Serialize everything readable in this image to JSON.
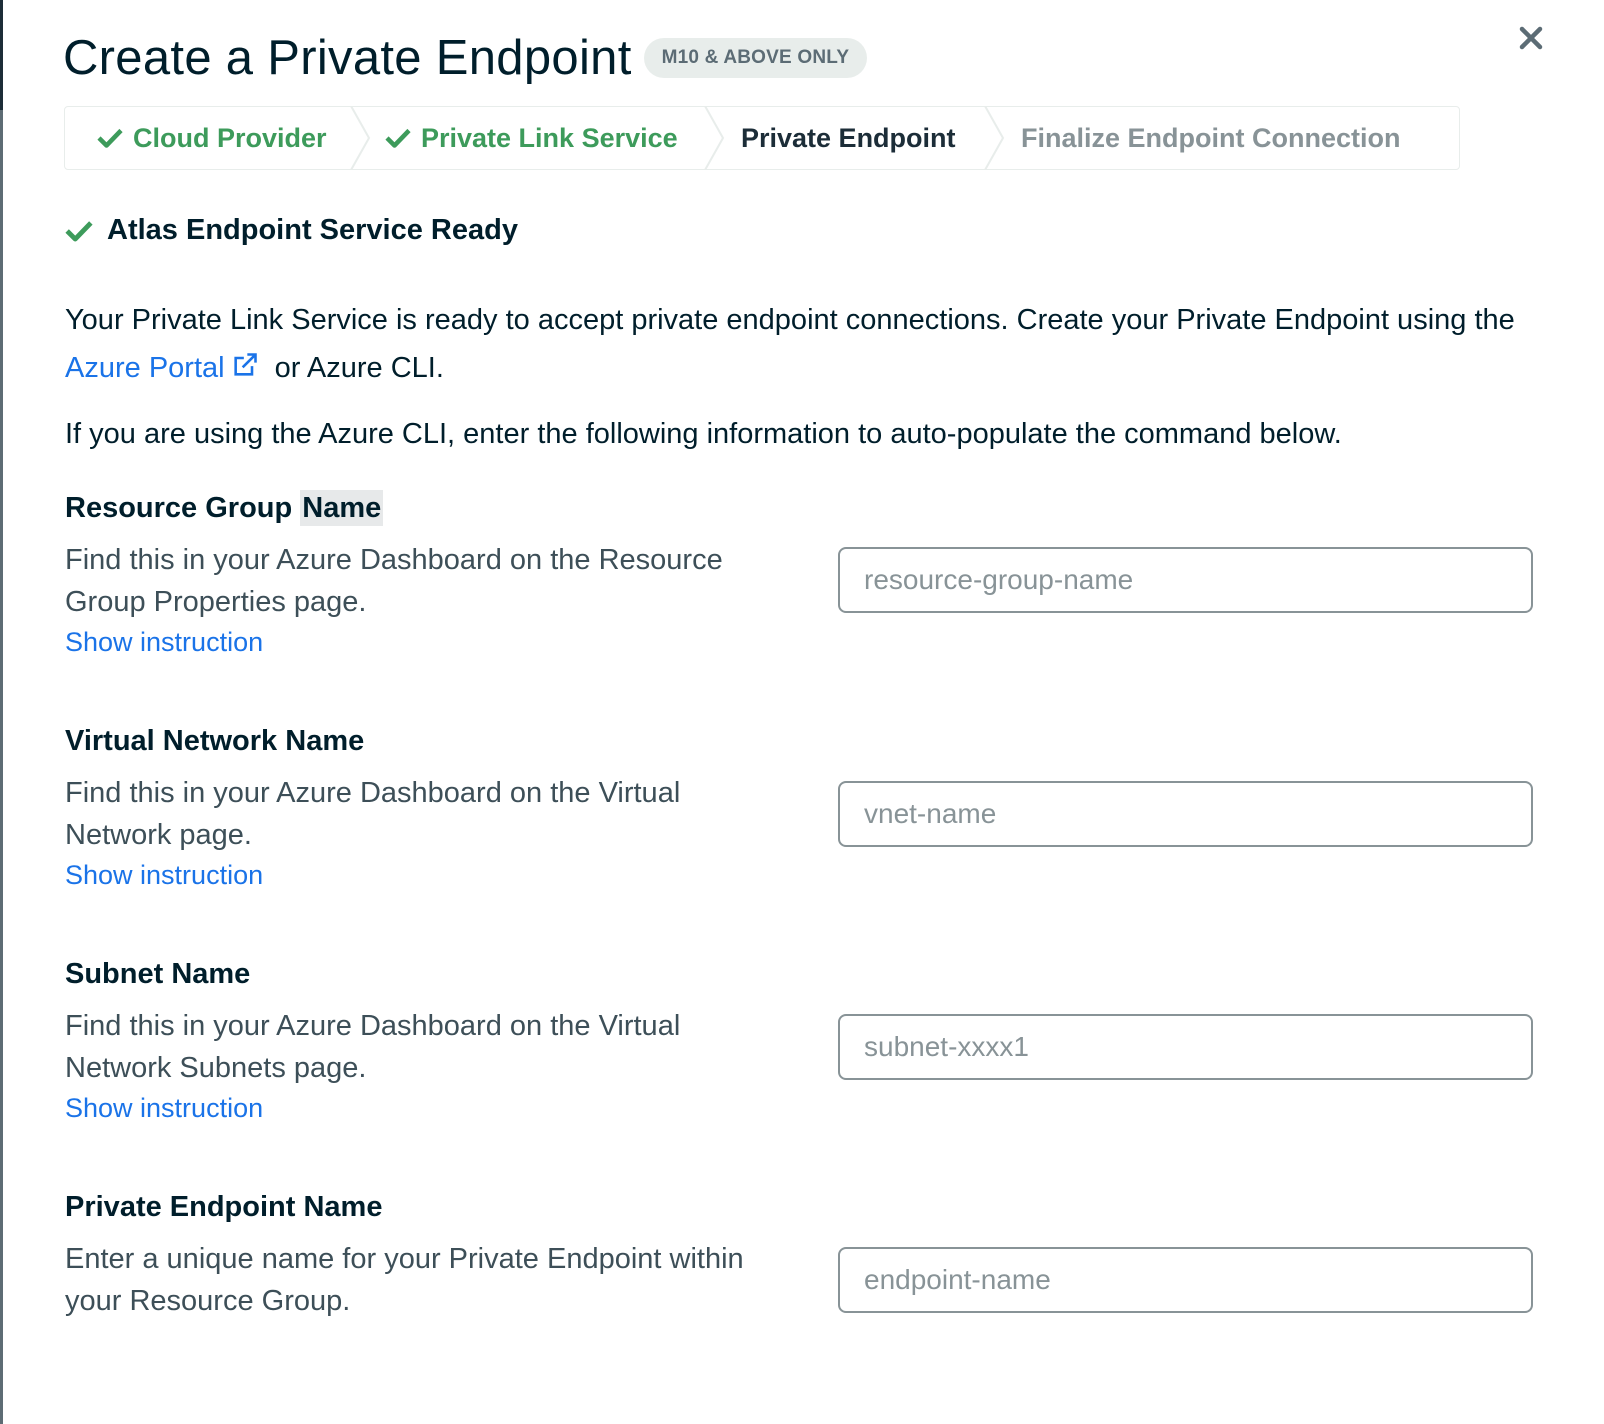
{
  "modal": {
    "title": "Create a Private Endpoint",
    "badge": "M10 & ABOVE ONLY",
    "close_icon": "close-icon"
  },
  "wizard": {
    "steps": [
      {
        "label": "Cloud Provider",
        "state": "done"
      },
      {
        "label": "Private Link Service",
        "state": "done"
      },
      {
        "label": "Private Endpoint",
        "state": "active"
      },
      {
        "label": "Finalize Endpoint Connection",
        "state": "future"
      }
    ]
  },
  "status": {
    "icon": "check-icon",
    "text": "Atlas Endpoint Service Ready"
  },
  "intro": {
    "line1": "Your Private Link Service is ready to accept private endpoint connections. Create your Private Endpoint using the ",
    "portal_link": "Azure Portal",
    "line1_end": " or Azure CLI.",
    "line2": "If you are using the Azure CLI, enter the following information to auto-populate the command below."
  },
  "fields": [
    {
      "label_a": "Resource Group ",
      "label_b": "Name",
      "description": "Find this in your Azure Dashboard on the Resource Group Properties page.",
      "show_link": "Show instruction",
      "placeholder": "resource-group-name",
      "value": ""
    },
    {
      "label": "Virtual Network Name",
      "description": "Find this in your Azure Dashboard on the Virtual Network page.",
      "show_link": "Show instruction",
      "placeholder": "vnet-name",
      "value": ""
    },
    {
      "label": "Subnet Name",
      "description": "Find this in your Azure Dashboard on the Virtual Network Subnets page.",
      "show_link": "Show instruction",
      "placeholder": "subnet-xxxx1",
      "value": ""
    },
    {
      "label": "Private Endpoint Name",
      "description": "Enter a unique name for your Private Endpoint within your Resource Group.",
      "placeholder": "endpoint-name",
      "value": ""
    }
  ],
  "colors": {
    "success": "#3d9b5b",
    "link": "#1a73e8",
    "text": "#001e2b",
    "muted": "#889397"
  }
}
